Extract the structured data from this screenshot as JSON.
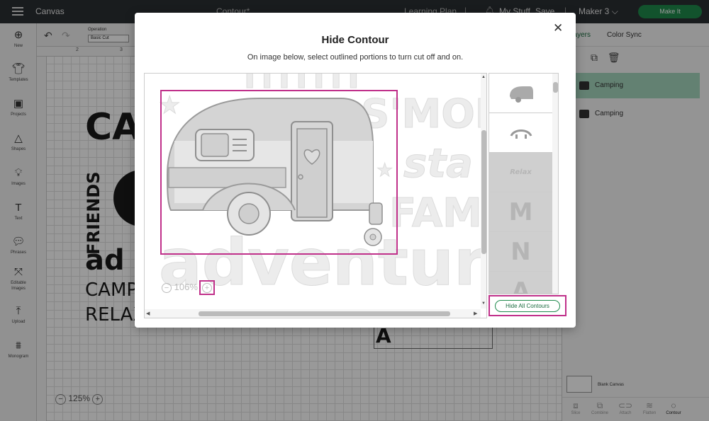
{
  "topbar": {
    "app_title": "Canvas",
    "project_title": "Contour*",
    "learning_plan": "Learning Plan",
    "my_stuff": "My Stuff",
    "save": "Save",
    "machine": "Maker 3",
    "make_it": "Make It"
  },
  "leftbar": {
    "tools": [
      {
        "label": "New",
        "icon": "plus-circle-icon"
      },
      {
        "label": "Templates",
        "icon": "shirt-icon"
      },
      {
        "label": "Projects",
        "icon": "projects-icon"
      },
      {
        "label": "Shapes",
        "icon": "shapes-icon"
      },
      {
        "label": "Images",
        "icon": "lightbulb-icon"
      },
      {
        "label": "Text",
        "icon": "text-icon"
      },
      {
        "label": "Phrases",
        "icon": "speech-bubble-icon"
      },
      {
        "label": "Editable Images",
        "icon": "editable-images-icon"
      },
      {
        "label": "Upload",
        "icon": "upload-icon"
      },
      {
        "label": "Monogram",
        "icon": "monogram-icon"
      }
    ]
  },
  "toolbar": {
    "operation_label": "Operation",
    "operation_value": "Basic Cut"
  },
  "canvas": {
    "ruler_marks": [
      "2",
      "3"
    ],
    "zoom": "125%"
  },
  "rightpanel": {
    "tabs": [
      "Layers",
      "Color Sync"
    ],
    "layers": [
      {
        "name": "Camping",
        "selected": true
      },
      {
        "name": "Camping",
        "selected": false
      }
    ],
    "blank_canvas": "Blank Canvas",
    "bottom_tools": [
      {
        "label": "Slice",
        "icon": "slice-icon"
      },
      {
        "label": "Combine",
        "icon": "combine-icon"
      },
      {
        "label": "Attach",
        "icon": "attach-icon"
      },
      {
        "label": "Flatten",
        "icon": "flatten-icon"
      },
      {
        "label": "Contour",
        "icon": "contour-icon",
        "active": true
      }
    ]
  },
  "modal": {
    "title": "Hide Contour",
    "subtitle": "On image below, select outlined portions to turn cut off and on.",
    "zoom": "106%",
    "thumbnails": [
      {
        "glyph": "camper",
        "hidden": false
      },
      {
        "glyph": "wheel",
        "hidden": false
      },
      {
        "glyph": "Relax",
        "hidden": true
      },
      {
        "glyph": "M",
        "hidden": true
      },
      {
        "glyph": "N",
        "hidden": true
      },
      {
        "glyph": "A",
        "hidden": true
      }
    ],
    "hide_all_button": "Hide All Contours"
  },
  "colors": {
    "accent": "#1f8a4c",
    "highlight": "#c0308a",
    "selected_layer": "#a6d7bf"
  }
}
